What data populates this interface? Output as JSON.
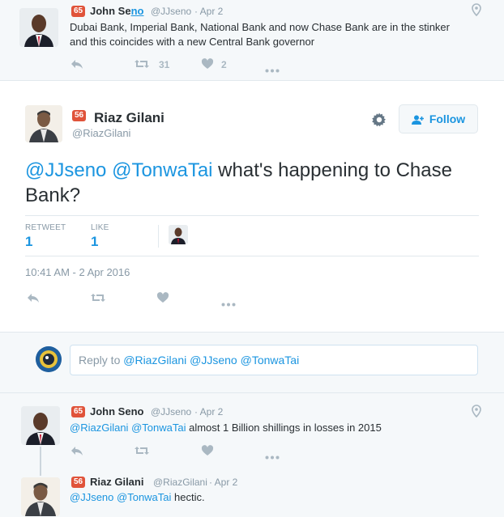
{
  "top_tweet": {
    "badge": "65",
    "name_prefix": "John Se",
    "name_link": "no",
    "handle": "@JJseno",
    "date": "· Apr 2",
    "text_line1": "Dubai Bank, Imperial Bank, National Bank and now Chase Bank are in the stinker",
    "text_line2": "and this coincides with a new Central Bank governor",
    "retweets": "31",
    "likes": "2"
  },
  "main_tweet": {
    "badge": "56",
    "name": "Riaz Gilani",
    "handle": "@RiazGilani",
    "follow_label": "Follow",
    "mention1": "@JJseno",
    "mention2": "@TonwaTai",
    "text_rest": " what's happening to Chase",
    "text_line2": "Bank?",
    "retweet_label": "RETWEET",
    "retweet_count": "1",
    "like_label": "LIKE",
    "like_count": "1",
    "timestamp": "10:41 AM - 2 Apr 2016"
  },
  "reply_box": {
    "prefix": "Reply to ",
    "mentions": "@RiazGilani @JJseno @TonwaTai"
  },
  "reply1": {
    "badge": "65",
    "name": "John Seno",
    "handle": "@JJseno",
    "date": "· Apr 2",
    "mention1": "@RiazGilani",
    "mention2": "@TonwaTai",
    "text_rest": " almost 1 Billion shillings in losses in 2015"
  },
  "reply2": {
    "badge": "56",
    "name": "Riaz Gilani",
    "handle": "@RiazGilani",
    "date": "· Apr 2",
    "mention1": "@JJseno",
    "mention2": "@TonwaTai",
    "text_rest": " hectic."
  },
  "colors": {
    "link": "#1b95e0",
    "badge": "#e0533a",
    "muted": "#8899a6",
    "background_alt": "#f5f8fa"
  }
}
